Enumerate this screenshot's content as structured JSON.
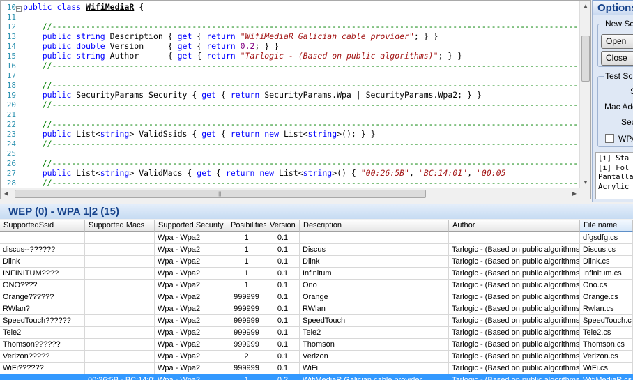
{
  "editor": {
    "lines": [
      {
        "num": "10",
        "fold": true,
        "segs": [
          {
            "t": "public",
            "c": "kw"
          },
          {
            "t": " "
          },
          {
            "t": "class",
            "c": "kw"
          },
          {
            "t": " "
          },
          {
            "t": "WifiMediaR",
            "c": "cls"
          },
          {
            "t": " {"
          }
        ]
      },
      {
        "num": "11",
        "segs": []
      },
      {
        "num": "12",
        "segs": [
          {
            "t": "    "
          },
          {
            "t": "//------------------------------------------------------------------------------------------------------------------------------------------",
            "c": "cm"
          }
        ]
      },
      {
        "num": "13",
        "segs": [
          {
            "t": "    "
          },
          {
            "t": "public",
            "c": "kw"
          },
          {
            "t": " "
          },
          {
            "t": "string",
            "c": "kw"
          },
          {
            "t": " Description { "
          },
          {
            "t": "get",
            "c": "kw"
          },
          {
            "t": " { "
          },
          {
            "t": "return",
            "c": "kw"
          },
          {
            "t": " "
          },
          {
            "t": "\"WifiMediaR Galician cable provider\"",
            "c": "str"
          },
          {
            "t": "; } }"
          }
        ]
      },
      {
        "num": "14",
        "segs": [
          {
            "t": "    "
          },
          {
            "t": "public",
            "c": "kw"
          },
          {
            "t": " "
          },
          {
            "t": "double",
            "c": "kw"
          },
          {
            "t": " Version     { "
          },
          {
            "t": "get",
            "c": "kw"
          },
          {
            "t": " { "
          },
          {
            "t": "return",
            "c": "kw"
          },
          {
            "t": " "
          },
          {
            "t": "0.2",
            "c": "num"
          },
          {
            "t": "; } }"
          }
        ]
      },
      {
        "num": "15",
        "segs": [
          {
            "t": "    "
          },
          {
            "t": "public",
            "c": "kw"
          },
          {
            "t": " "
          },
          {
            "t": "string",
            "c": "kw"
          },
          {
            "t": " Author      { "
          },
          {
            "t": "get",
            "c": "kw"
          },
          {
            "t": " { "
          },
          {
            "t": "return",
            "c": "kw"
          },
          {
            "t": " "
          },
          {
            "t": "\"Tarlogic - (Based on public algorithms)\"",
            "c": "str"
          },
          {
            "t": "; } }"
          }
        ]
      },
      {
        "num": "16",
        "segs": [
          {
            "t": "    "
          },
          {
            "t": "//------------------------------------------------------------------------------------------------------------------------------------------",
            "c": "cm"
          }
        ]
      },
      {
        "num": "17",
        "segs": []
      },
      {
        "num": "18",
        "segs": [
          {
            "t": "    "
          },
          {
            "t": "//------------------------------------------------------------------------------------------------------------------------------------------",
            "c": "cm"
          }
        ]
      },
      {
        "num": "19",
        "segs": [
          {
            "t": "    "
          },
          {
            "t": "public",
            "c": "kw"
          },
          {
            "t": " SecurityParams Security { "
          },
          {
            "t": "get",
            "c": "kw"
          },
          {
            "t": " { "
          },
          {
            "t": "return",
            "c": "kw"
          },
          {
            "t": " SecurityParams.Wpa | SecurityParams.Wpa2; } }"
          }
        ]
      },
      {
        "num": "20",
        "segs": [
          {
            "t": "    "
          },
          {
            "t": "//------------------------------------------------------------------------------------------------------------------------------------------",
            "c": "cm"
          }
        ]
      },
      {
        "num": "21",
        "segs": []
      },
      {
        "num": "22",
        "segs": [
          {
            "t": "    "
          },
          {
            "t": "//------------------------------------------------------------------------------------------------------------------------------------------",
            "c": "cm"
          }
        ]
      },
      {
        "num": "23",
        "segs": [
          {
            "t": "    "
          },
          {
            "t": "public",
            "c": "kw"
          },
          {
            "t": " List<"
          },
          {
            "t": "string",
            "c": "kw"
          },
          {
            "t": "> ValidSsids { "
          },
          {
            "t": "get",
            "c": "kw"
          },
          {
            "t": " { "
          },
          {
            "t": "return",
            "c": "kw"
          },
          {
            "t": " "
          },
          {
            "t": "new",
            "c": "kw"
          },
          {
            "t": " List<"
          },
          {
            "t": "string",
            "c": "kw"
          },
          {
            "t": ">(); } }"
          }
        ]
      },
      {
        "num": "24",
        "segs": [
          {
            "t": "    "
          },
          {
            "t": "//------------------------------------------------------------------------------------------------------------------------------------------",
            "c": "cm"
          }
        ]
      },
      {
        "num": "25",
        "segs": []
      },
      {
        "num": "26",
        "segs": [
          {
            "t": "    "
          },
          {
            "t": "//------------------------------------------------------------------------------------------------------------------------------------------",
            "c": "cm"
          }
        ]
      },
      {
        "num": "27",
        "segs": [
          {
            "t": "    "
          },
          {
            "t": "public",
            "c": "kw"
          },
          {
            "t": " List<"
          },
          {
            "t": "string",
            "c": "kw"
          },
          {
            "t": "> ValidMacs { "
          },
          {
            "t": "get",
            "c": "kw"
          },
          {
            "t": " { "
          },
          {
            "t": "return",
            "c": "kw"
          },
          {
            "t": " "
          },
          {
            "t": "new",
            "c": "kw"
          },
          {
            "t": " List<"
          },
          {
            "t": "string",
            "c": "kw"
          },
          {
            "t": ">() { "
          },
          {
            "t": "\"00:26:5B\"",
            "c": "str"
          },
          {
            "t": ", "
          },
          {
            "t": "\"BC:14:01\"",
            "c": "str"
          },
          {
            "t": ", "
          },
          {
            "t": "\"00:05",
            "c": "str"
          }
        ]
      },
      {
        "num": "28",
        "segs": [
          {
            "t": "    "
          },
          {
            "t": "//------------------------------------------------------------------------------------------------------------------------------------------",
            "c": "cm"
          }
        ]
      }
    ]
  },
  "options": {
    "title": "Options",
    "new_script_group": "New Scr",
    "open_label": "Open",
    "close_label": "Close",
    "test_script_group": "Test Scr",
    "label_s": "S",
    "label_mac": "Mac Add",
    "label_sec": "Sec",
    "wpa_label": "WPA",
    "log": "[i] Sta\n[i] Fol\nPantalla\nAcrylic"
  },
  "grid": {
    "title": "WEP (0) - WPA 1|2 (15)",
    "columns": [
      "SupportedSsid",
      "Supported Macs",
      "Supported Security",
      "Posibilities",
      "Version",
      "Description",
      "Author",
      "File name"
    ],
    "rows": [
      [
        "",
        "",
        "Wpa - Wpa2",
        "1",
        "0.1",
        "",
        "",
        "dfgsdfg.cs"
      ],
      [
        "discus--??????",
        "",
        "Wpa - Wpa2",
        "1",
        "0.1",
        "Discus",
        "Tarlogic - (Based on public algorithms)",
        "Discus.cs"
      ],
      [
        "Dlink",
        "",
        "Wpa - Wpa2",
        "1",
        "0.1",
        "Dlink",
        "Tarlogic - (Based on public algorithms)",
        "Dlink.cs"
      ],
      [
        "INFINITUM????",
        "",
        "Wpa - Wpa2",
        "1",
        "0.1",
        "Infinitum",
        "Tarlogic - (Based on public algorithms)",
        "Infinitum.cs"
      ],
      [
        "ONO????",
        "",
        "Wpa - Wpa2",
        "1",
        "0.1",
        "Ono",
        "Tarlogic - (Based on public algorithms)",
        "Ono.cs"
      ],
      [
        "Orange??????",
        "",
        "Wpa - Wpa2",
        "999999",
        "0.1",
        "Orange",
        "Tarlogic - (Based on public algorithms)",
        "Orange.cs"
      ],
      [
        "RWlan?",
        "",
        "Wpa - Wpa2",
        "999999",
        "0.1",
        "RWlan",
        "Tarlogic - (Based on public algorithms)",
        "Rwlan.cs"
      ],
      [
        "SpeedTouch??????",
        "",
        "Wpa - Wpa2",
        "999999",
        "0.1",
        "SpeedTouch",
        "Tarlogic - (Based on public algorithms)",
        "SpeedTouch.cs"
      ],
      [
        "Tele2",
        "",
        "Wpa - Wpa2",
        "999999",
        "0.1",
        "Tele2",
        "Tarlogic - (Based on public algorithms)",
        "Tele2.cs"
      ],
      [
        "Thomson??????",
        "",
        "Wpa - Wpa2",
        "999999",
        "0.1",
        "Thomson",
        "Tarlogic - (Based on public algorithms)",
        "Thomson.cs"
      ],
      [
        "Verizon?????",
        "",
        "Wpa - Wpa2",
        "2",
        "0.1",
        "Verizon",
        "Tarlogic - (Based on public algorithms)",
        "Verizon.cs"
      ],
      [
        "WiFi??????",
        "",
        "Wpa - Wpa2",
        "999999",
        "0.1",
        "WiFi",
        "Tarlogic - (Based on public algorithms)",
        "WiFi.cs"
      ],
      [
        "",
        "00:26:5B - BC:14:01",
        "Wpa - Wpa2",
        "1",
        "0.2",
        "WifiMediaR Galician cable provider",
        "Tarlogic - (Based on public algorithms)",
        "WifiMediaR.cs"
      ]
    ],
    "selected_row": 12
  }
}
